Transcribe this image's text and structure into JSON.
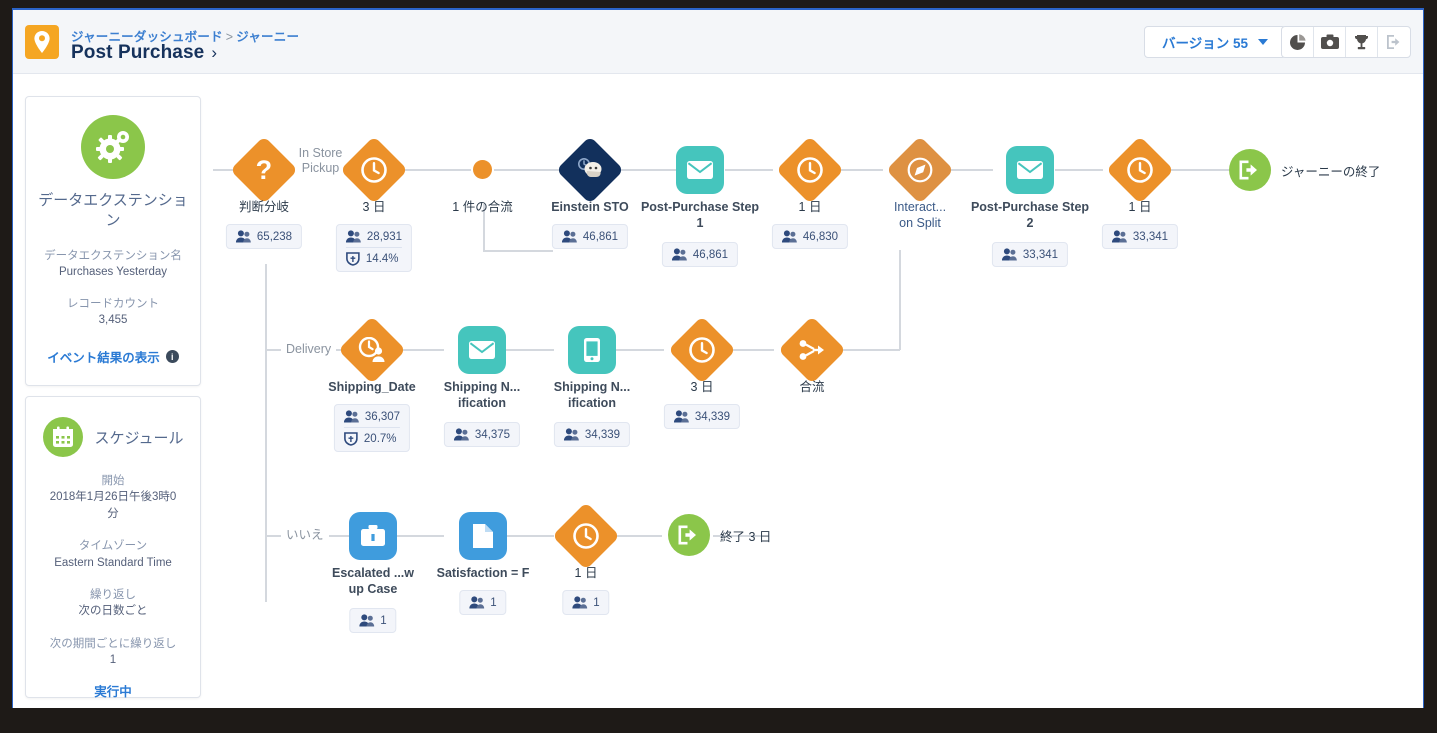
{
  "header": {
    "breadcrumb_parent": "ジャーニーダッシュボード",
    "breadcrumb_sep": ">",
    "breadcrumb_current": "ジャーニー",
    "title": "Post Purchase",
    "title_chevron": "›",
    "version_label": "バージョン 55",
    "icons": [
      "pie-chart-icon",
      "camera-icon",
      "trophy-icon",
      "exit-icon"
    ],
    "pin_icon": "location-pin-icon"
  },
  "sidebar": {
    "entry": {
      "icon": "gears-icon",
      "title": "データエクステンション",
      "field1_label": "データエクステンション名",
      "field1_value": "Purchases Yesterday",
      "field2_label": "レコードカウント",
      "field2_value": "3,455",
      "link": "イベント結果の表示",
      "badge": "i"
    },
    "schedule": {
      "icon": "calendar-icon",
      "title": "スケジュール",
      "field1_label": "開始",
      "field1_value": "2018年1月26日午後3時0分",
      "field2_label": "タイムゾーン",
      "field2_value": "Eastern Standard Time",
      "field3_label": "繰り返し",
      "field3_value": "次の日数ごと",
      "field4_label": "次の期間ごとに繰り返し",
      "field4_value": "1",
      "status": "実行中"
    }
  },
  "canvas": {
    "path_labels": {
      "in_store_pickup": "In Store Pickup",
      "delivery": "Delivery",
      "no": "いいえ"
    },
    "row1": [
      {
        "name": "decision-split",
        "label": "判断分岐",
        "icon": "question-mark-icon",
        "shape": "diamond-orange",
        "count": "65,238"
      },
      {
        "name": "wait-3-days",
        "label": "3 日",
        "icon": "clock-icon",
        "shape": "diamond-orange",
        "count": "28,931",
        "rate": "14.4%"
      },
      {
        "name": "merge-point",
        "label": "1 件の合流",
        "icon": "merge-dot-icon",
        "shape": "dot-orange"
      },
      {
        "name": "einstein-sto",
        "label": "Einstein STO",
        "icon": "einstein-icon",
        "shape": "diamond-navy",
        "count": "46,861"
      },
      {
        "name": "email-post-purchase-step-1",
        "label": "Post-Purchase Step 1",
        "icon": "email-icon",
        "shape": "square-teal",
        "count": "46,861"
      },
      {
        "name": "wait-1-day-a",
        "label": "1 日",
        "icon": "clock-icon",
        "shape": "diamond-orange",
        "count": "46,830"
      },
      {
        "name": "interaction-split",
        "label": "Interact...\non Split",
        "icon": "compass-icon",
        "shape": "diamond-orange-light"
      },
      {
        "name": "email-post-purchase-step-2",
        "label": "Post-Purchase Step 2",
        "icon": "email-icon",
        "shape": "square-teal",
        "count": "33,341"
      },
      {
        "name": "wait-1-day-b",
        "label": "1 日",
        "icon": "clock-icon",
        "shape": "diamond-orange",
        "count": "33,341"
      },
      {
        "name": "journey-end",
        "label": "ジャーニーの終了",
        "icon": "exit-icon",
        "shape": "circle-green"
      }
    ],
    "row2": [
      {
        "name": "wait-shipping-date",
        "label": "Shipping_Date",
        "icon": "date-clock-icon",
        "shape": "diamond-orange",
        "count": "36,307",
        "rate": "20.7%"
      },
      {
        "name": "email-shipping-notification",
        "label": "Shipping N...\nification",
        "icon": "email-icon",
        "shape": "square-teal",
        "count": "34,375"
      },
      {
        "name": "sms-shipping-notification",
        "label": "Shipping N...\nification",
        "icon": "mobile-icon",
        "shape": "square-teal",
        "count": "34,339"
      },
      {
        "name": "wait-3-days-b",
        "label": "3 日",
        "icon": "clock-icon",
        "shape": "diamond-orange",
        "count": "34,339"
      },
      {
        "name": "join",
        "label": "合流",
        "icon": "join-icon",
        "shape": "diamond-orange"
      }
    ],
    "row3": [
      {
        "name": "escalated-follow-up-case",
        "label": "Escalated ...w\nup Case",
        "icon": "briefcase-icon",
        "shape": "square-blue",
        "count": "1"
      },
      {
        "name": "satisfaction-f",
        "label": "Satisfaction = F",
        "icon": "document-icon",
        "shape": "square-blue",
        "count": "1"
      },
      {
        "name": "wait-1-day-c",
        "label": "1 日",
        "icon": "clock-icon",
        "shape": "diamond-orange",
        "count": "1"
      },
      {
        "name": "end-3-days",
        "label": "終了 3 日",
        "icon": "exit-icon",
        "shape": "circle-green"
      }
    ]
  },
  "colors": {
    "orange": "#ec912a",
    "orange_light": "#de9142",
    "navy": "#12305c",
    "teal": "#45c5bd",
    "blue": "#3f9cdd",
    "green": "#8bc64a",
    "link": "#2a7ad4"
  }
}
